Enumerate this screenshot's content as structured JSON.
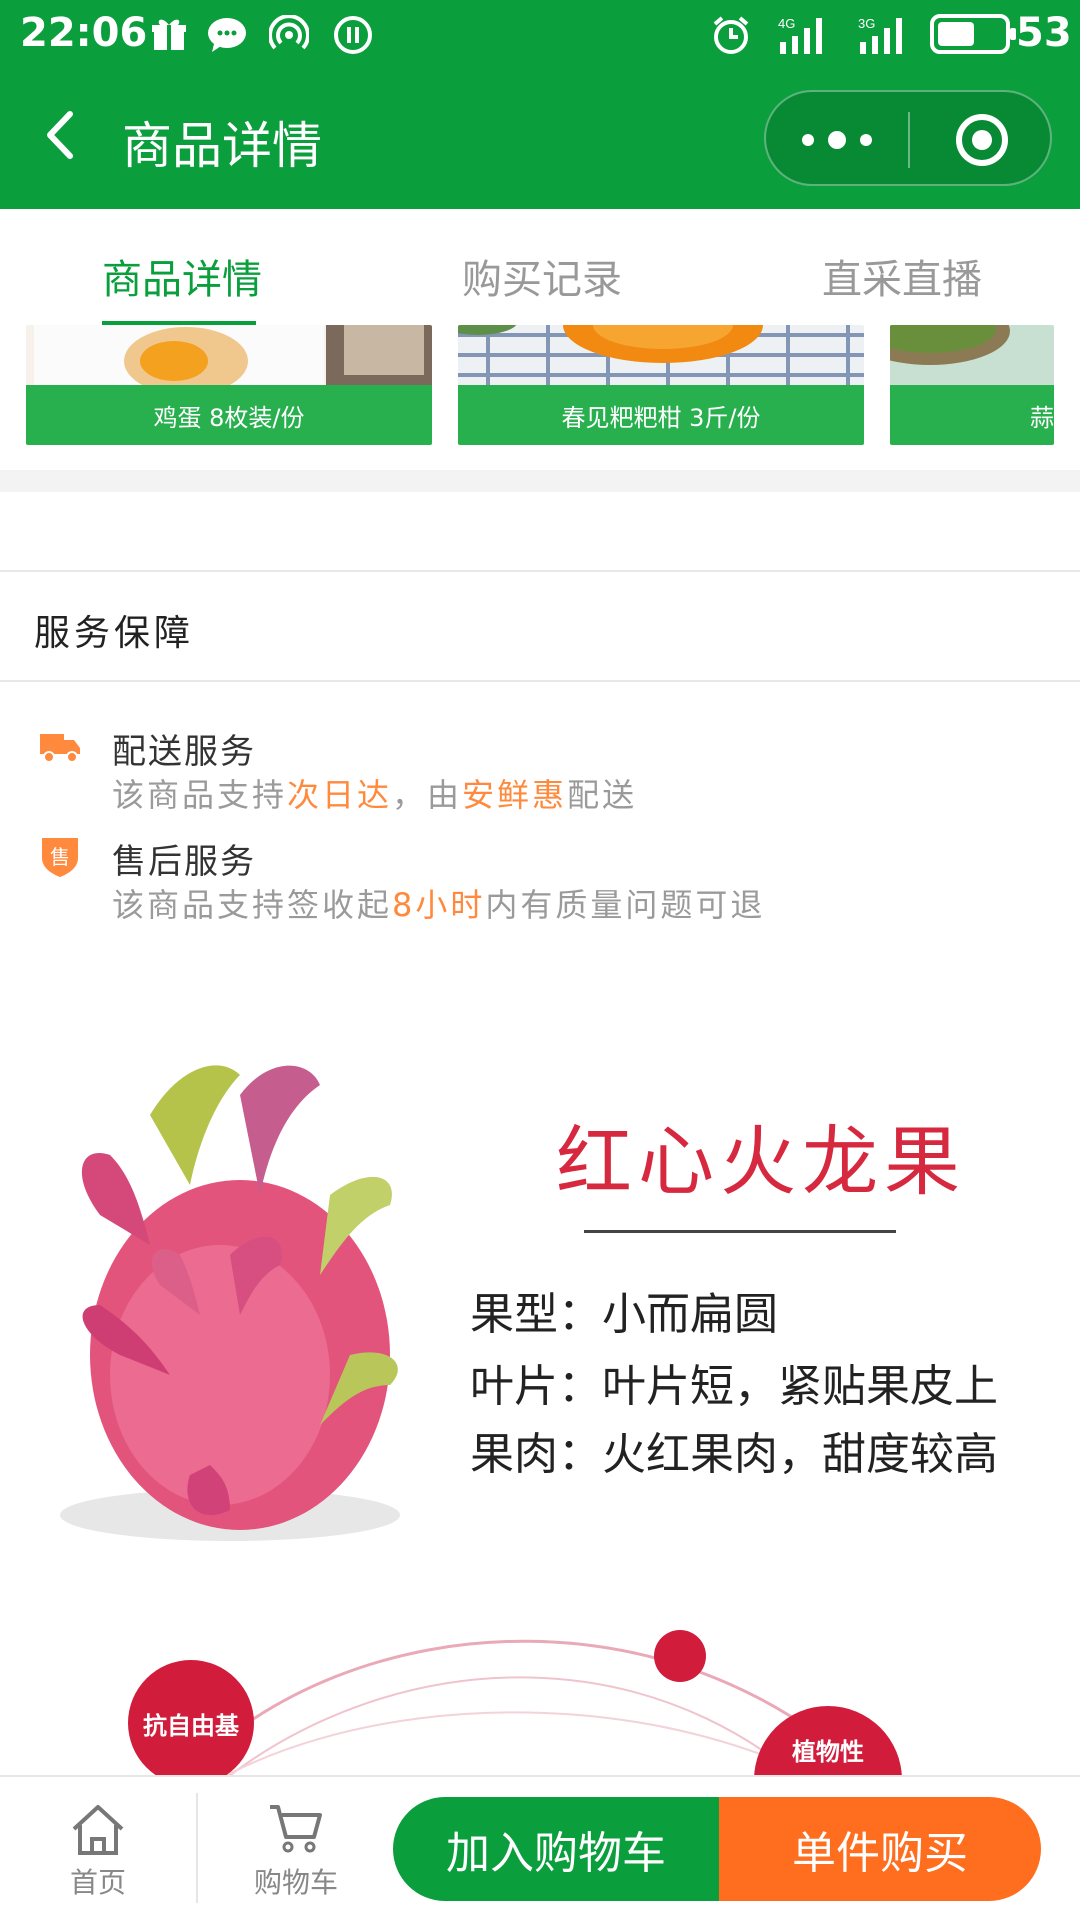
{
  "status_bar": {
    "time": "22:06",
    "battery": "53",
    "network_1": "4G",
    "network_2": "3G"
  },
  "header": {
    "title": "商品详情"
  },
  "tabs": [
    {
      "label": "商品详情",
      "active": true
    },
    {
      "label": "购买记录",
      "active": false
    },
    {
      "label": "直采直播",
      "active": false
    }
  ],
  "products": [
    {
      "label": "鸡蛋 8枚装/份"
    },
    {
      "label": "春见粑粑柑 3斤/份"
    },
    {
      "label": "蒜"
    }
  ],
  "service": {
    "title": "服务保障",
    "delivery": {
      "heading": "配送服务",
      "desc_1": "该商品支持",
      "desc_hl_1": "次日达",
      "desc_2": "，由",
      "desc_hl_2": "安鲜惠",
      "desc_3": "配送"
    },
    "after_sales": {
      "heading": "售后服务",
      "badge": "售",
      "desc_1": "该商品支持签收起",
      "desc_hl_1": "8小时",
      "desc_2": "内有质量问题可退"
    }
  },
  "promo": {
    "title": "红心火龙果",
    "rows": [
      "果型：小而扁圆",
      "叶片：叶片短，紧贴果皮上",
      "果肉：火红果肉，甜度较高"
    ],
    "badge_1": "抗自由基",
    "badge_2": "植物性"
  },
  "bottom_nav": {
    "home_label": "首页",
    "cart_label": "购物车",
    "add_cart_label": "加入购物车",
    "buy_label": "单件购买"
  },
  "colors": {
    "brand_green": "#0a9e3d",
    "accent_orange": "#ff6d1f",
    "highlight": "#ff8a3d",
    "promo_red": "#d6283e"
  }
}
